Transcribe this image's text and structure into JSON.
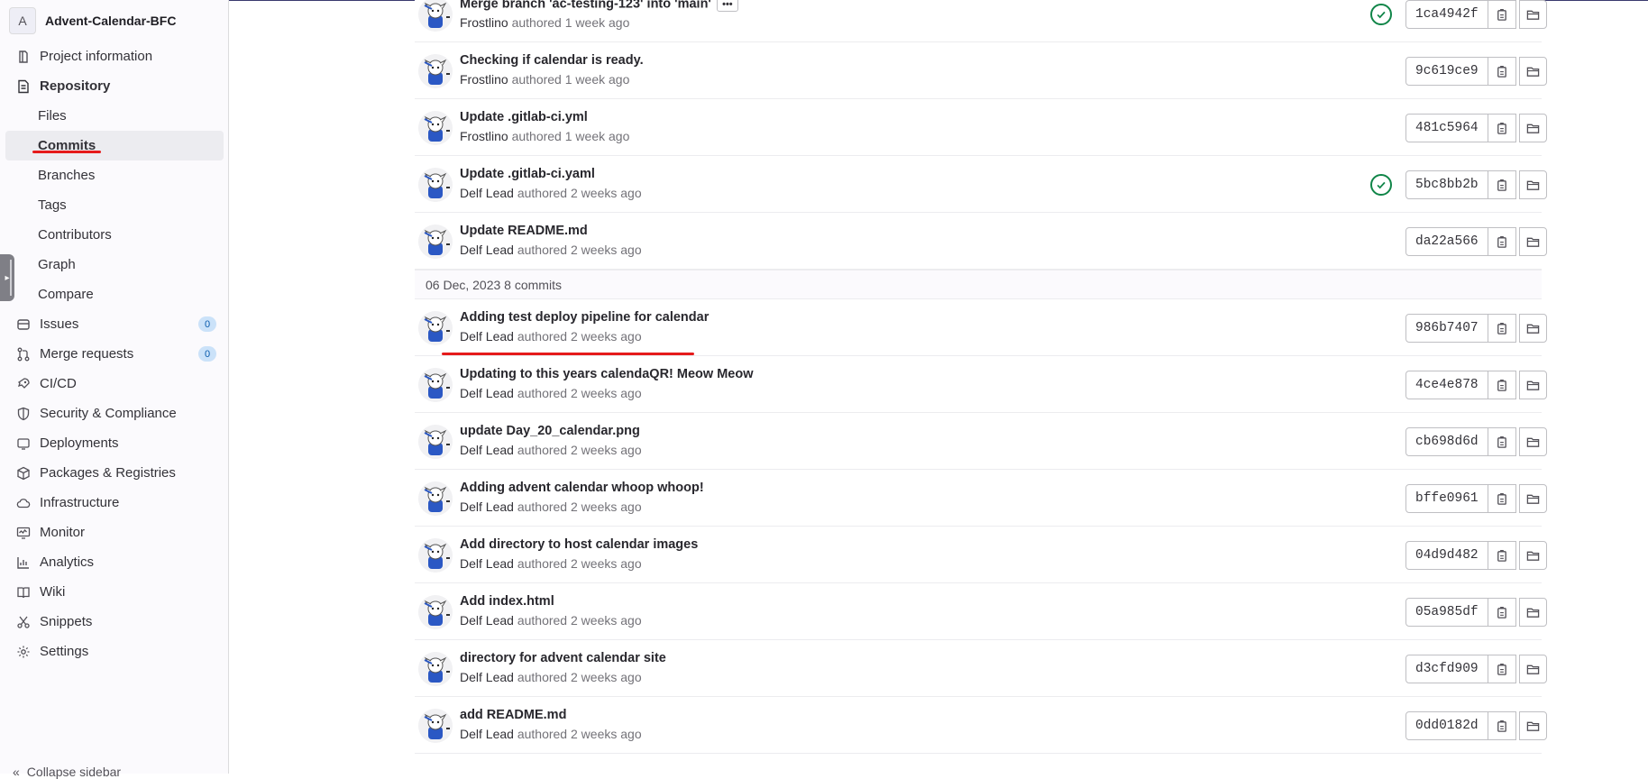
{
  "sidebar": {
    "project_initial": "A",
    "project_name": "Advent-Calendar-BFC",
    "items": [
      {
        "label": "Project information",
        "icon": "project-info-icon"
      },
      {
        "label": "Repository",
        "icon": "repository-icon"
      },
      {
        "label": "Files"
      },
      {
        "label": "Commits"
      },
      {
        "label": "Branches"
      },
      {
        "label": "Tags"
      },
      {
        "label": "Contributors"
      },
      {
        "label": "Graph"
      },
      {
        "label": "Compare"
      },
      {
        "label": "Issues",
        "icon": "issues-icon",
        "count": "0"
      },
      {
        "label": "Merge requests",
        "icon": "merge-request-icon",
        "count": "0"
      },
      {
        "label": "CI/CD",
        "icon": "rocket-icon"
      },
      {
        "label": "Security & Compliance",
        "icon": "shield-icon"
      },
      {
        "label": "Deployments",
        "icon": "deployments-icon"
      },
      {
        "label": "Packages & Registries",
        "icon": "package-icon"
      },
      {
        "label": "Infrastructure",
        "icon": "cloud-icon"
      },
      {
        "label": "Monitor",
        "icon": "monitor-icon"
      },
      {
        "label": "Analytics",
        "icon": "chart-icon"
      },
      {
        "label": "Wiki",
        "icon": "book-icon"
      },
      {
        "label": "Snippets",
        "icon": "scissors-icon"
      },
      {
        "label": "Settings",
        "icon": "gear-icon"
      }
    ],
    "collapse_label": "Collapse sidebar"
  },
  "commits_top": [
    {
      "title": "Merge branch 'ac-testing-123' into 'main'",
      "author": "Frostlino",
      "verb": "authored",
      "time": "1 week ago",
      "sha": "1ca4942f",
      "status": "passed",
      "has_more": true
    },
    {
      "title": "Checking if calendar is ready.",
      "author": "Frostlino",
      "verb": "authored",
      "time": "1 week ago",
      "sha": "9c619ce9",
      "status": ""
    },
    {
      "title": "Update .gitlab-ci.yml",
      "author": "Frostlino",
      "verb": "authored",
      "time": "1 week ago",
      "sha": "481c5964",
      "status": ""
    },
    {
      "title": "Update .gitlab-ci.yaml",
      "author": "Delf Lead",
      "verb": "authored",
      "time": "2 weeks ago",
      "sha": "5bc8bb2b",
      "status": "passed"
    },
    {
      "title": "Update README.md",
      "author": "Delf Lead",
      "verb": "authored",
      "time": "2 weeks ago",
      "sha": "da22a566",
      "status": ""
    }
  ],
  "day_header": "06 Dec, 2023 8 commits",
  "commits_day": [
    {
      "title": "Adding test deploy pipeline for calendar",
      "author": "Delf Lead",
      "verb": "authored",
      "time": "2 weeks ago",
      "sha": "986b7407"
    },
    {
      "title": "Updating to this years calendaQR! Meow Meow",
      "author": "Delf Lead",
      "verb": "authored",
      "time": "2 weeks ago",
      "sha": "4ce4e878"
    },
    {
      "title": "update Day_20_calendar.png",
      "author": "Delf Lead",
      "verb": "authored",
      "time": "2 weeks ago",
      "sha": "cb698d6d"
    },
    {
      "title": "Adding advent calendar whoop whoop!",
      "author": "Delf Lead",
      "verb": "authored",
      "time": "2 weeks ago",
      "sha": "bffe0961"
    },
    {
      "title": "Add directory to host calendar images",
      "author": "Delf Lead",
      "verb": "authored",
      "time": "2 weeks ago",
      "sha": "04d9d482"
    },
    {
      "title": "Add index.html",
      "author": "Delf Lead",
      "verb": "authored",
      "time": "2 weeks ago",
      "sha": "05a985df"
    },
    {
      "title": "directory for advent calendar site",
      "author": "Delf Lead",
      "verb": "authored",
      "time": "2 weeks ago",
      "sha": "d3cfd909"
    },
    {
      "title": "add README.md",
      "author": "Delf Lead",
      "verb": "authored",
      "time": "2 weeks ago",
      "sha": "0dd0182d"
    }
  ],
  "colors": {
    "accent_red": "#e51b1b",
    "status_green": "#108548",
    "badge_blue": "#cbe2f9"
  }
}
